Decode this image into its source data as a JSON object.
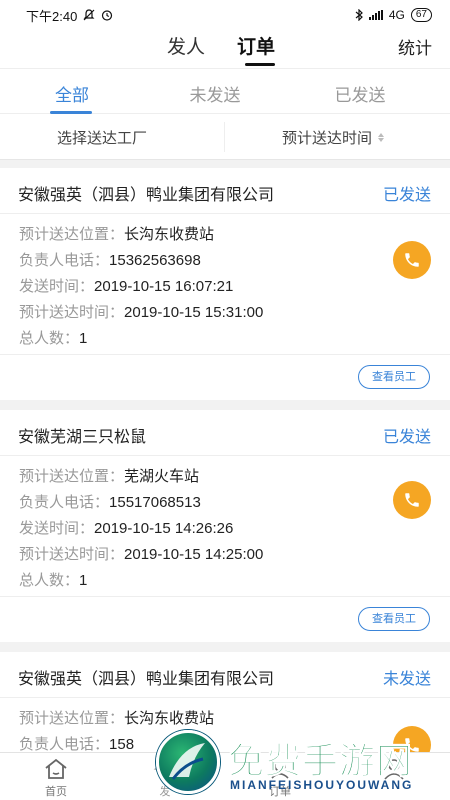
{
  "status_bar": {
    "time": "下午2:40",
    "network": "4G",
    "battery": "67"
  },
  "top_nav": {
    "tab_send": "发人",
    "tab_order": "订单",
    "stats": "统计"
  },
  "status_tabs": {
    "all": "全部",
    "unsent": "未发送",
    "sent": "已发送"
  },
  "filters": {
    "factory": "选择送达工厂",
    "time": "预计送达时间"
  },
  "labels": {
    "location": "预计送达位置：",
    "phone": "负责人电话：",
    "send_time": "发送时间：",
    "eta": "预计送达时间：",
    "count": "总人数：",
    "view_staff": "查看员工"
  },
  "orders": [
    {
      "company": "安徽强英（泗县）鸭业集团有限公司",
      "status": "已发送",
      "location": "长沟东收费站",
      "phone": "15362563698",
      "send_time": "2019-10-15 16:07:21",
      "eta": "2019-10-15 15:31:00",
      "count": "1"
    },
    {
      "company": "安徽芜湖三只松鼠",
      "status": "已发送",
      "location": "芜湖火车站",
      "phone": "15517068513",
      "send_time": "2019-10-15 14:26:26",
      "eta": "2019-10-15 14:25:00",
      "count": "1"
    },
    {
      "company": "安徽强英（泗县）鸭业集团有限公司",
      "status": "未发送",
      "location": "长沟东收费站",
      "phone": "158"
    }
  ],
  "bottom_nav": {
    "home": "首页",
    "send": "发",
    "order": "订单"
  },
  "watermark": {
    "title": "免费手游网",
    "sub": "MIANFEISHOUYOUWANG"
  },
  "colors": {
    "accent": "#3a84d8",
    "phone_button": "#f5a623",
    "label": "#999999"
  }
}
